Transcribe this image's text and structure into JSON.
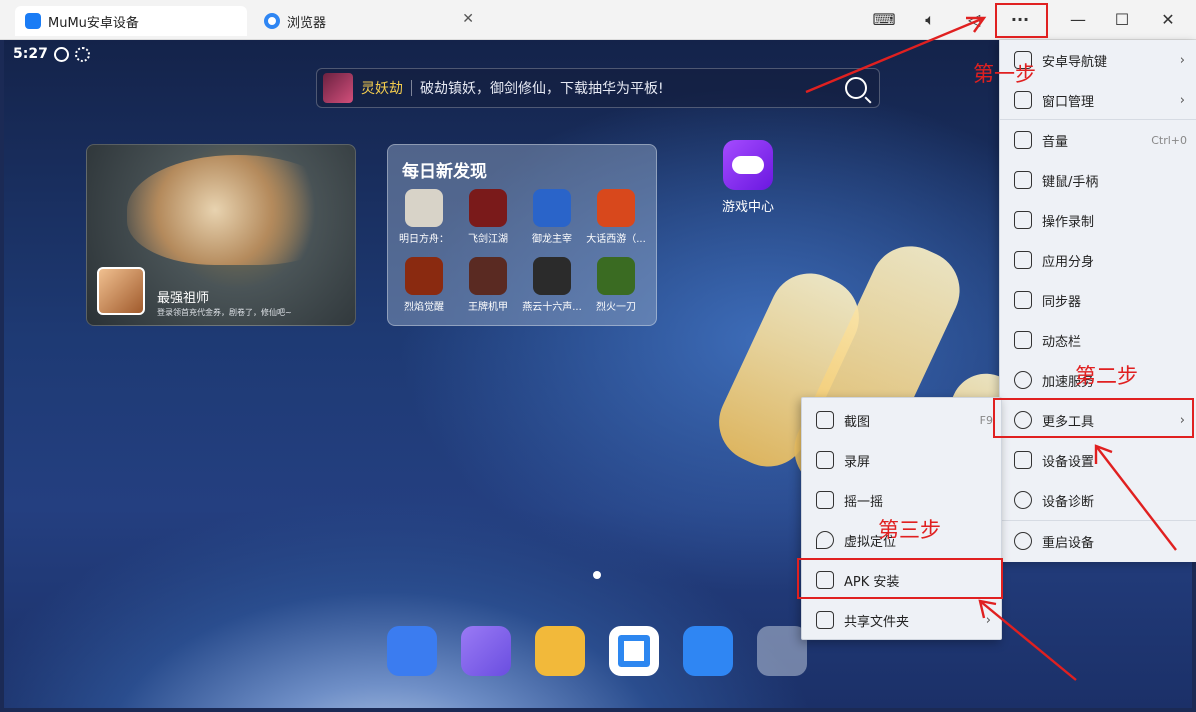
{
  "titlebar": {
    "tabs": [
      {
        "label": "MuMu安卓设备",
        "icon": "mumu-logo-icon"
      },
      {
        "label": "浏览器",
        "icon": "browser-icon",
        "close": "✕"
      }
    ],
    "window_buttons": {
      "minimize": "—",
      "maximize": "☐",
      "close": "✕"
    },
    "more_label": "···"
  },
  "status": {
    "time": "5:27"
  },
  "search": {
    "game": "灵妖劫",
    "text": "破劫镇妖，御剑修仙，下载抽华为平板!"
  },
  "feature_card": {
    "title": "最强祖师",
    "desc": "登录领首充代金券，剧卷了，修仙吧~"
  },
  "daily": {
    "title": "每日新发现",
    "games": [
      {
        "label": "明日方舟：",
        "color": "#d8d3c8"
      },
      {
        "label": "飞剑江湖",
        "color": "#7a1a1a"
      },
      {
        "label": "御龙主宰",
        "color": "#2a64c9"
      },
      {
        "label": "大话西游（...",
        "color": "#d8481c"
      },
      {
        "label": "烈焰觉醒",
        "color": "#8a2a10"
      },
      {
        "label": "王牌机甲",
        "color": "#5a2a22"
      },
      {
        "label": "燕云十六声...",
        "color": "#2b2b2b"
      },
      {
        "label": "烈火一刀",
        "color": "#3a6b22"
      }
    ]
  },
  "game_center": {
    "label": "游戏中心"
  },
  "menu": {
    "items": [
      {
        "label": "安卓导航键",
        "arrow": "›"
      },
      {
        "label": "窗口管理",
        "arrow": "›"
      },
      {
        "label": "音量",
        "shortcut": "Ctrl+0"
      },
      {
        "label": "键鼠/手柄"
      },
      {
        "label": "操作录制"
      },
      {
        "label": "应用分身"
      },
      {
        "label": "同步器"
      },
      {
        "label": "动态栏"
      },
      {
        "label": "加速服务"
      },
      {
        "label": "更多工具",
        "arrow": "›"
      },
      {
        "label": "设备设置"
      },
      {
        "label": "设备诊断"
      },
      {
        "label": "重启设备"
      }
    ]
  },
  "submenu": {
    "items": [
      {
        "label": "截图",
        "shortcut": "F9"
      },
      {
        "label": "录屏"
      },
      {
        "label": "摇一摇"
      },
      {
        "label": "虚拟定位"
      },
      {
        "label": "APK 安装"
      },
      {
        "label": "共享文件夹",
        "arrow": "›"
      }
    ]
  },
  "annotations": {
    "step1": "第一步",
    "step2": "第二步",
    "step3": "第三步",
    "color": "#e02020"
  }
}
